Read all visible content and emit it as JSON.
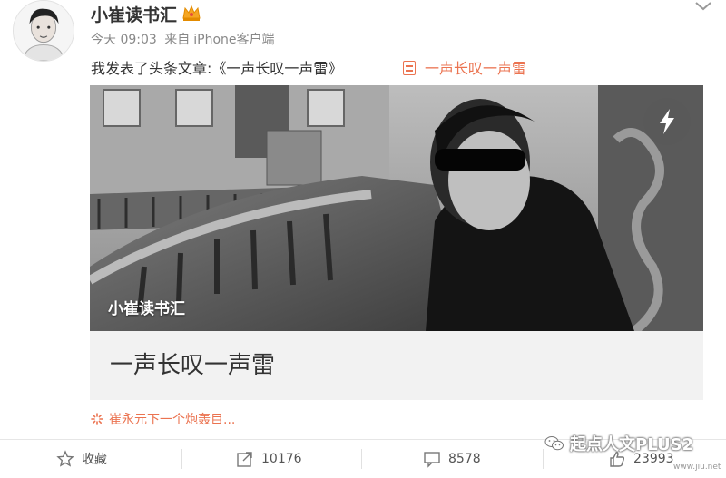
{
  "user": {
    "name": "小崔读书汇",
    "time": "今天 09:03",
    "source_prefix": "来自",
    "source_client": "iPhone客户端"
  },
  "post": {
    "text": "我发表了头条文章:《一声长叹一声雷》",
    "article_link": "一声长叹一声雷"
  },
  "card": {
    "watermark": "小崔读书汇",
    "title": "一声长叹一声雷"
  },
  "source_line": "崔永元下一个炮轰目...",
  "actions": {
    "favorite": "收藏",
    "repost": "10176",
    "comment": "8578",
    "like": "23993"
  },
  "overlay": {
    "brand": "起点人文PLUS2",
    "url": "www.jiu.net"
  },
  "colors": {
    "accent": "#eb7350",
    "text": "#333333",
    "muted": "#888888"
  },
  "icons": [
    "crown-icon",
    "chevron-down-icon",
    "doc-icon",
    "flash-icon",
    "spark-icon",
    "star-icon",
    "share-icon",
    "comment-icon",
    "thumb-icon",
    "wechat-icon"
  ]
}
